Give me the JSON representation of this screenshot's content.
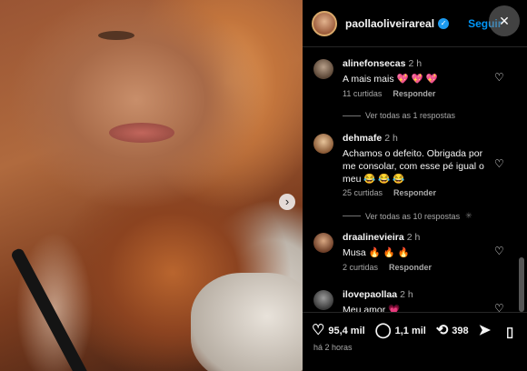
{
  "post": {
    "username": "paollaoliveirareal",
    "verified_badge": "verified-badge-icon",
    "follow_label": "Seguir",
    "close_icon": "close-icon"
  },
  "comments": [
    {
      "username": "alinefonsecas",
      "time": "2 h",
      "text": "A mais mais 💖 💖 💖",
      "likes": "11 curtidas",
      "reply_label": "Responder",
      "view_replies": "Ver todas as 1 respostas"
    },
    {
      "username": "dehmafe",
      "time": "2 h",
      "text": "Achamos o defeito. Obrigada por me consolar, com esse pé igual o meu 😂 😂 😂",
      "likes": "25 curtidas",
      "reply_label": "Responder",
      "view_replies": "Ver todas as 10 respostas"
    },
    {
      "username": "draalinevieira",
      "time": "2 h",
      "text": "Musa 🔥 🔥 🔥",
      "likes": "2 curtidas",
      "reply_label": "Responder"
    },
    {
      "username": "ilovepaollaa",
      "time": "2 h",
      "text": "Meu amor 💗"
    }
  ],
  "actions": {
    "likes": "95,4 mil",
    "comments": "1,1 mil",
    "reposts": "398",
    "time_ago": "há 2 horas"
  },
  "colors": {
    "accent": "#0095f6",
    "background": "#000000",
    "secondary_text": "#a8a8a8"
  }
}
